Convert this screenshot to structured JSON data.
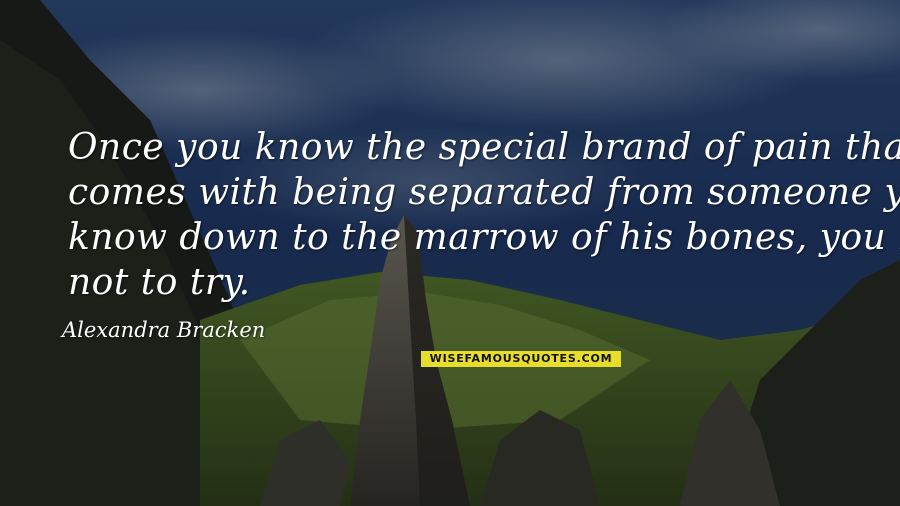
{
  "quote": {
    "lines": [
      "Once you know the special brand of pain that",
      "comes with being separated from someone you",
      "know down to the marrow of his bones, you learn",
      "not to try."
    ],
    "author": "Alexandra Bracken"
  },
  "watermark": {
    "text": "WISEFAMOUSQUOTES.COM",
    "color": "#e9dd2b"
  },
  "colors": {
    "text": "#ffffff",
    "sky": "#1f3a66",
    "grass": "#56702e"
  }
}
